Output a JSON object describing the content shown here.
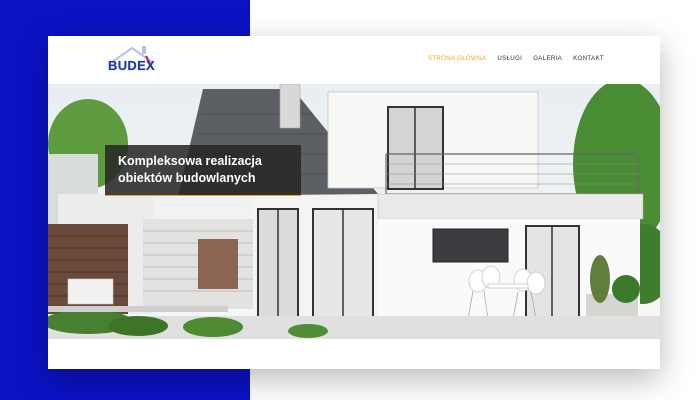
{
  "brand": {
    "logo_text": "BUDEX",
    "colors": {
      "primary_blue": "#2333a8",
      "accent_orange": "#f0a52b",
      "red_accent": "#d91c1c"
    }
  },
  "nav": {
    "items": [
      {
        "label": "STRONA GŁÓWNA",
        "active": true
      },
      {
        "label": "USŁUGI",
        "active": false
      },
      {
        "label": "GALERIA",
        "active": false
      },
      {
        "label": "KONTAKT",
        "active": false
      }
    ]
  },
  "hero": {
    "title": "Kompleksowa realizacja obiektów budowlanych",
    "image": "modern-house-render"
  },
  "page_background": {
    "left_color": "#0b12c4",
    "right_color": "#ffffff"
  }
}
